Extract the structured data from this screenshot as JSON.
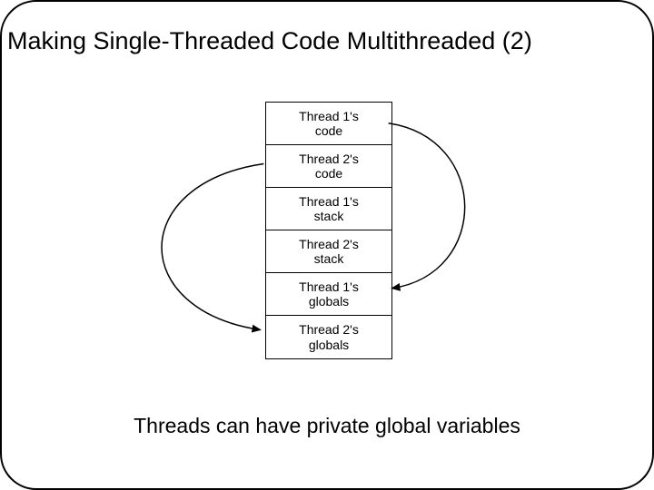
{
  "title": "Making Single-Threaded Code Multithreaded (2)",
  "cells": {
    "c0a": "Thread 1's",
    "c0b": "code",
    "c1a": "Thread 2's",
    "c1b": "code",
    "c2a": "Thread 1's",
    "c2b": "stack",
    "c3a": "Thread 2's",
    "c3b": "stack",
    "c4a": "Thread 1's",
    "c4b": "globals",
    "c5a": "Thread 2's",
    "c5b": "globals"
  },
  "caption": "Threads can have private global variables"
}
